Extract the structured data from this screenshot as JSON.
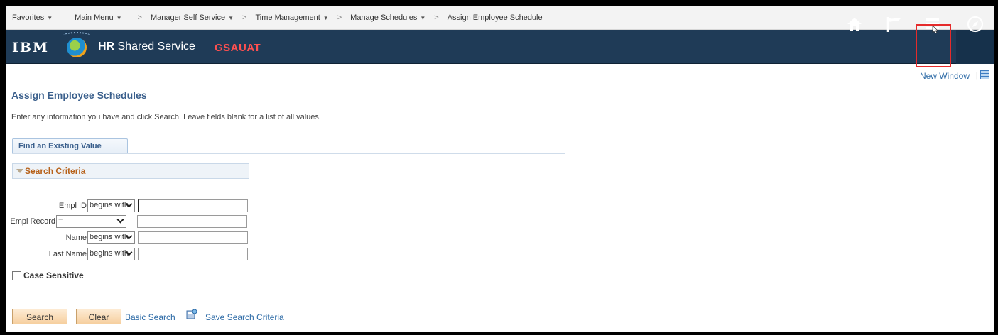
{
  "breadcrumb": {
    "favorites": "Favorites",
    "main_menu": "Main Menu",
    "sep": ">",
    "manager": "Manager Self Service",
    "time": "Time Management",
    "schedules": "Manage Schedules",
    "current": "Assign Employee Schedule"
  },
  "banner": {
    "logo": "IBM",
    "brand_bold": "HR",
    "brand_rest": " Shared Service",
    "env": "GSAUAT",
    "icons": [
      "home-icon",
      "flag-icon",
      "menu-icon",
      "navigator-icon"
    ]
  },
  "links": {
    "new_window": "New Window",
    "pipe": "|"
  },
  "page": {
    "title": "Assign Employee Schedules",
    "instructions": "Enter any information you have and click Search. Leave fields blank for a list of all values."
  },
  "tab": {
    "label": "Find an Existing Value"
  },
  "section": {
    "label": "Search Criteria"
  },
  "fields": [
    {
      "label": "Empl ID",
      "operator": "begins with",
      "value": ""
    },
    {
      "label": "Empl Record",
      "operator": "=",
      "value": ""
    },
    {
      "label": "Name",
      "operator": "begins with",
      "value": ""
    },
    {
      "label": "Last Name",
      "operator": "begins with",
      "value": ""
    }
  ],
  "case_sensitive": {
    "label": "Case Sensitive",
    "checked": false
  },
  "actions": {
    "search": "Search",
    "clear": "Clear",
    "basic_search": "Basic Search",
    "save_criteria": "Save Search Criteria"
  },
  "colors": {
    "banner": "#1f3b57",
    "env": "#ff5050",
    "highlight": "#e52b2b",
    "section_label": "#b7621b",
    "link": "#2c6aa6"
  }
}
